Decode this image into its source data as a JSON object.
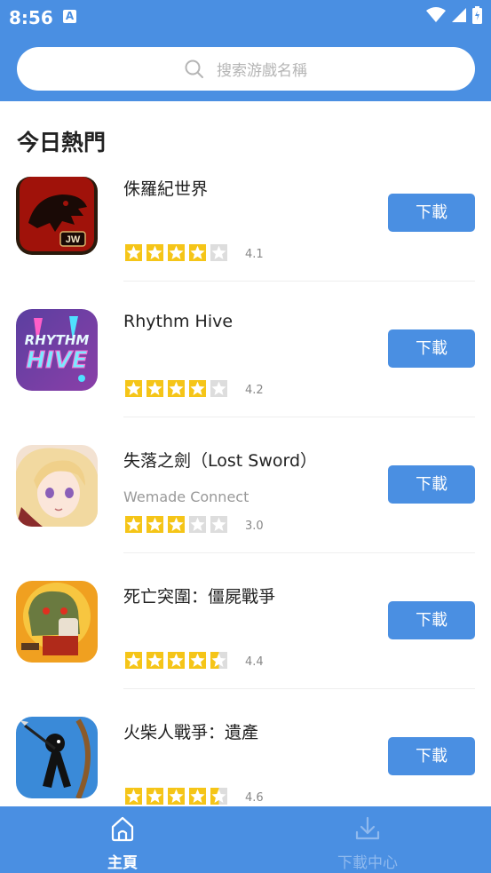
{
  "status_bar": {
    "time": "8:56",
    "notification_icon": "A"
  },
  "search": {
    "placeholder": "搜索游戲名稱"
  },
  "section": {
    "title": "今日熱門"
  },
  "games": [
    {
      "name": "侏羅紀世界",
      "developer": "",
      "rating": "4.1",
      "stars": 4,
      "button": "下載",
      "icon": "dinosaur-skull-icon"
    },
    {
      "name": "Rhythm Hive",
      "developer": "",
      "rating": "4.2",
      "stars": 4,
      "button": "下載",
      "icon": "rhythm-hive-icon"
    },
    {
      "name": "失落之劍（Lost Sword）",
      "developer": "Wemade Connect",
      "rating": "3.0",
      "stars": 3,
      "button": "下載",
      "icon": "anime-girl-icon"
    },
    {
      "name": "死亡突圍：僵屍戰爭",
      "developer": "",
      "rating": "4.4",
      "stars": 4.5,
      "button": "下載",
      "icon": "zombie-icon"
    },
    {
      "name": "火柴人戰爭：遺產",
      "developer": "",
      "rating": "4.6",
      "stars": 4.5,
      "button": "下載",
      "icon": "stickman-icon"
    }
  ],
  "nav": {
    "home_label": "主頁",
    "download_center_label": "下載中心"
  },
  "colors": {
    "brand": "#4a8fe2",
    "star": "#f5c518"
  }
}
